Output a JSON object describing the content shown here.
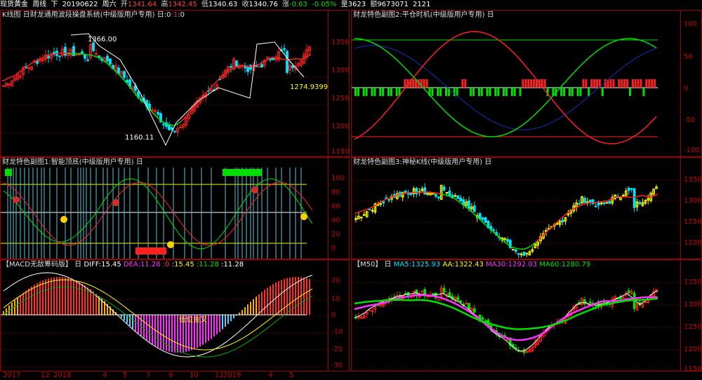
{
  "topbar": {
    "symbol": "现货黄金",
    "period": "周线",
    "dir": "下",
    "date": "20190622",
    "weekday": "周六",
    "open_label": "开",
    "open": "1341.64",
    "high_label": "高",
    "high": "1342.45",
    "low_label": "低",
    "low": "1340.63",
    "close_label": "收",
    "close": "1340.76",
    "chg_label": "涨",
    "chg": "-0.63",
    "pct": "-0.05%",
    "vol_label": "量",
    "vol": "3623",
    "amt_label": "额",
    "amt": "9673071",
    "extra": "2121"
  },
  "panels": {
    "kline": {
      "title": "K线图 日财龙通用波段操盘系统(中级版用户专用)",
      "suffix_label": "日:0",
      "suffix_a": ":1",
      "suffix_b": ":0",
      "yticks": [
        "1350",
        "1300",
        "1250",
        "1200",
        "1150"
      ],
      "high_note": "1366.00",
      "low_note": "1160.11",
      "last_note": "1274.9399"
    },
    "sub2": {
      "title": "财龙特色副图2:平仓时机(中级版用户专用) 日",
      "yticks": [
        "100",
        "50",
        "0",
        "-50",
        "-100"
      ]
    },
    "sub1": {
      "title": "财龙特色副图1:智能顶底(中级版用户专用) 日",
      "yticks": [
        "100",
        "80",
        "60",
        "40",
        "20",
        "0"
      ]
    },
    "sub3": {
      "title": "财龙特色副图3:神秘K线(中级版用户专用) 日",
      "yticks": [
        "1350",
        "1300",
        "1250",
        "1200"
      ]
    },
    "macd": {
      "title": "【MACD无敌筹码版】 日",
      "diff": "DIFF:15.45",
      "dea": "DEA:11.28",
      "z": ":0",
      "v1": ":15.45",
      "v2": ":11.28",
      "v3": ":11.28",
      "cross_note": "低位金叉",
      "yticks": [
        "20",
        "10",
        "0",
        "-10",
        "-20",
        "-30"
      ]
    },
    "ma": {
      "title": "【M50】 日",
      "ma5": "MA5:1325.93",
      "aa": "AA:1322.43",
      "ma30": "MA30:1292.03",
      "ma60": "MA60:1280.79",
      "yticks": [
        "1350",
        "1300",
        "1250",
        "1200",
        "1150"
      ]
    }
  },
  "xaxis": [
    "2017",
    "12",
    "2018",
    "4",
    "5",
    "7",
    "9",
    "10",
    "12",
    "2019",
    "4",
    "5"
  ],
  "colors": {
    "up": "#ff2020",
    "down": "#00e5ff",
    "green": "#00e000",
    "yellow": "#ffff00",
    "magenta": "#ff30ff",
    "frame": "#a00000"
  }
}
